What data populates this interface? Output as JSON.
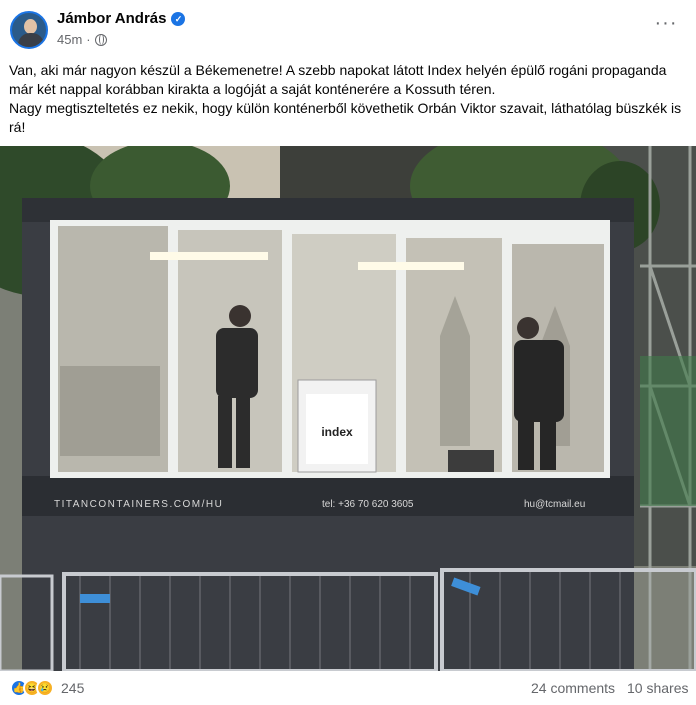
{
  "post": {
    "author": "Jámbor András",
    "time": "45m",
    "text_lines": [
      "Van, aki már nagyon készül a Békemenetre! A szebb napokat látott Index helyén épülő rogáni propaganda már két nappal korábban kirakta a logóját a saját konténerére a Kossuth téren.",
      "Nagy megtiszteltetés ez nekik, hogy külön konténerből követhetik Orbán Viktor szavait, láthatólag büszkék is rá!"
    ]
  },
  "photo": {
    "container_left": "TITANCONTAINERS.COM/HU",
    "container_phone": "tel: +36 70 620 3605",
    "container_email": "hu@tcmail.eu",
    "logo": "index"
  },
  "footer": {
    "reaction_count": "245",
    "comments": "24 comments",
    "shares": "10 shares"
  },
  "icons": {
    "verified": "verified-badge-icon",
    "audience": "globe-icon",
    "more": "more-options-icon"
  },
  "colors": {
    "accent": "#1b74e4",
    "secondary_text": "#65676b"
  }
}
